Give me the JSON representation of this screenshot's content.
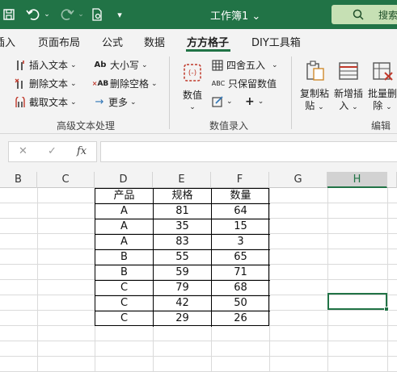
{
  "window": {
    "title": "工作簿1"
  },
  "search": {
    "label": "搜索"
  },
  "tabs": [
    "插入",
    "页面布局",
    "公式",
    "数据",
    "方方格子",
    "DIY工具箱"
  ],
  "ribbon": {
    "text_group": {
      "insert_text": "插入文本",
      "delete_text": "删除文本",
      "cut_text": "截取文本",
      "case": "大小写",
      "delete_space": "删除空格",
      "more": "更多",
      "label": "高级文本处理",
      "case_icon_text": "Ab",
      "space_icon_text": "AB"
    },
    "number_group": {
      "number_btn": "数值",
      "round": "四舍五入",
      "keep_number": "只保留数值",
      "label": "数值录入",
      "keep_icon_text": "ABC"
    },
    "edit_group": {
      "copy_paste_1": "复制粘",
      "copy_paste_2": "贴",
      "add_insert_1": "新增插",
      "add_insert_2": "入",
      "batch_delete_1": "批量删",
      "batch_delete_2": "除",
      "label": "编辑"
    }
  },
  "formula_bar": {
    "fx": "fx"
  },
  "columns": [
    "B",
    "C",
    "D",
    "E",
    "F",
    "G",
    "H"
  ],
  "selected_column": "H",
  "table": {
    "headers": [
      "产品",
      "规格",
      "数量"
    ],
    "rows": [
      [
        "A",
        "81",
        "64"
      ],
      [
        "A",
        "35",
        "15"
      ],
      [
        "A",
        "83",
        "3"
      ],
      [
        "B",
        "55",
        "65"
      ],
      [
        "B",
        "59",
        "71"
      ],
      [
        "C",
        "79",
        "68"
      ],
      [
        "C",
        "42",
        "50"
      ],
      [
        "C",
        "29",
        "26"
      ]
    ]
  },
  "colors": {
    "accent": "#217346",
    "ribbon_bg": "#f3f3f3",
    "grid_line": "#dadada"
  }
}
